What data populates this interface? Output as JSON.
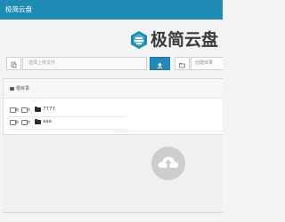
{
  "window": {
    "title": "极简云盘"
  },
  "brand": {
    "name": "极简云盘",
    "logo_icon": "cloud-box-logo-icon",
    "logo_color": "#1f8bb5"
  },
  "upload": {
    "file_icon": "file-icon",
    "file_placeholder": "选择上传文件",
    "upload_icon": "upload-icon",
    "upload_color": "#2489b9",
    "folder_icon": "folder-icon",
    "folder_placeholder": "创建目录"
  },
  "breadcrumb": {
    "root_icon": "folder-icon",
    "root_label": "根目录"
  },
  "list": {
    "up_icon": "parent-folder-icon",
    "items": [
      {
        "check1_label": "删",
        "check2_label": "改",
        "name": "7777"
      },
      {
        "check1_label": "删",
        "check2_label": "改",
        "name": "aaa"
      }
    ]
  },
  "drop": {
    "icon": "cloud-upload-icon"
  },
  "colors": {
    "topbar": "#1f8bb5"
  }
}
